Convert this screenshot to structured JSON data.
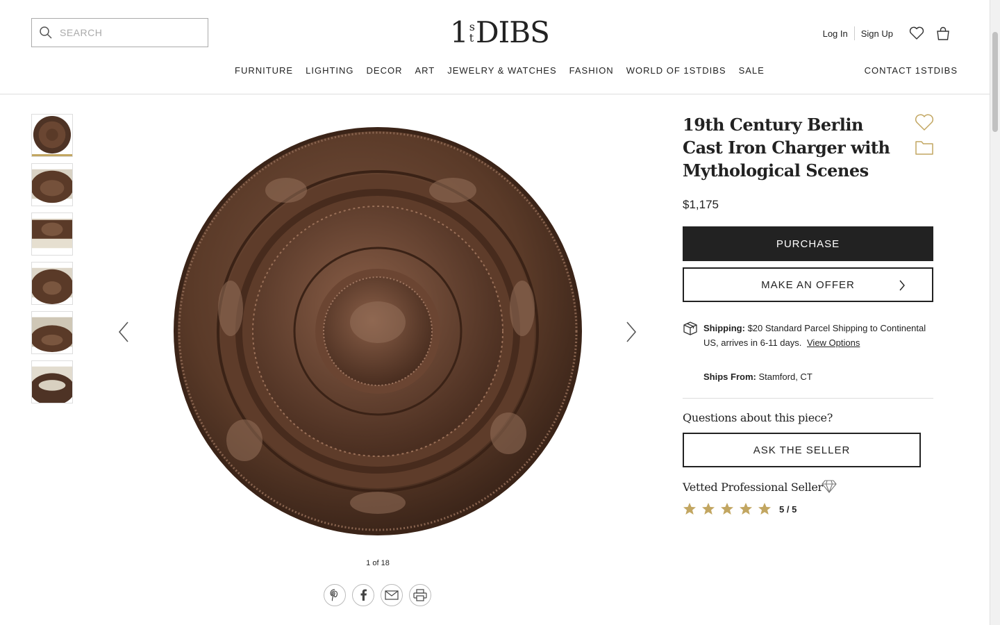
{
  "header": {
    "search_placeholder": "SEARCH",
    "logo_one": "1",
    "logo_s": "s",
    "logo_t": "t",
    "logo_dibs": "DIBS",
    "login": "Log In",
    "signup": "Sign Up"
  },
  "nav": {
    "items": [
      "FURNITURE",
      "LIGHTING",
      "DECOR",
      "ART",
      "JEWELRY & WATCHES",
      "FASHION",
      "WORLD OF 1STDIBS",
      "SALE"
    ],
    "contact": "CONTACT 1STDIBS"
  },
  "gallery": {
    "counter": "1 of 18"
  },
  "product": {
    "title": "19th Century Berlin Cast Iron Charger with Mythological Scenes",
    "price": "$1,175",
    "purchase_label": "PURCHASE",
    "offer_label": "MAKE AN OFFER",
    "shipping_label": "Shipping:",
    "shipping_text": "$20 Standard Parcel Shipping to Continental US, arrives in 6-11 days.",
    "view_options": "View Options",
    "ships_from_label": "Ships From:",
    "ships_from_value": "Stamford, CT",
    "questions": "Questions about this piece?",
    "ask_label": "ASK THE SELLER",
    "vetted": "Vetted Professional Seller",
    "rating": "5 / 5",
    "rating_value": 5
  },
  "colors": {
    "accent_gold": "#c2a661",
    "charger_bronze": "#5a3a28",
    "dark": "#222222"
  },
  "icons": [
    "search-icon",
    "heart-icon",
    "bag-icon",
    "chevron-left-icon",
    "chevron-right-icon",
    "pinterest-icon",
    "facebook-icon",
    "email-icon",
    "print-icon",
    "folder-icon",
    "shipping-box-icon",
    "diamond-icon",
    "star-icon"
  ]
}
